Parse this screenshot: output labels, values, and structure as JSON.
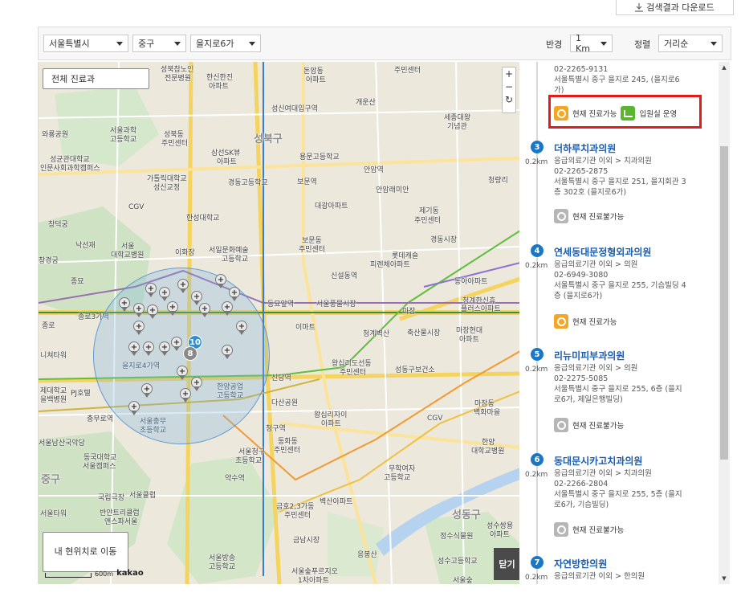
{
  "toolbar": {
    "download_label": "검색결과 다운로드",
    "download_icon": "download-icon"
  },
  "filters": {
    "sido": "서울특별시",
    "sigungu": "중구",
    "dong": "을지로6가",
    "radius_label": "반경",
    "radius_value": "1 Km",
    "sort_label": "정렬",
    "sort_value": "거리순"
  },
  "map": {
    "all_dept_button": "전체 진료과",
    "my_location_button": "내 현위치로 이동",
    "close_button": "닫기",
    "zoom_in": "+",
    "zoom_out": "−",
    "scale_text": "600m",
    "provider": "kakao",
    "clusters": [
      "10",
      "8"
    ],
    "labels": {
      "l1": "성북참노인",
      "l2": "전문병원",
      "l3": "한신한진",
      "l4": "아파트",
      "l5": "돈암동",
      "l6": "아파트",
      "l7": "주민센터",
      "l8": "성신여대입구역",
      "l9": "개운산",
      "l10": "와룡공원",
      "l11": "서울과학",
      "l12": "고등학교",
      "l13": "성북동",
      "l14": "주민센터",
      "l15": "성북구",
      "l16": "삼선SK뷰",
      "l17": "아파트",
      "l18": "용문고등학교",
      "l19": "세종대왕",
      "l20": "기념관",
      "l21": "성균관대학교",
      "l22": "인문사회과학캠퍼스",
      "l23": "가톨릭대학교",
      "l24": "성신교정",
      "l25": "경동고등학교",
      "l26": "보문역",
      "l27": "안암역",
      "l28": "안암래미안",
      "l29": "청량리",
      "l30": "CGV",
      "l31": "한성대학교",
      "l32": "대광아파트",
      "l33": "제기동",
      "l34": "주민센터",
      "l35": "창덕궁",
      "l36": "낙선재",
      "l37": "서울",
      "l38": "대학교병원",
      "l39": "이화장",
      "l40": "서일문화예술",
      "l41": "고등학교",
      "l42": "보문동",
      "l43": "주민센터",
      "l44": "경동시장",
      "l45": "종묘",
      "l46": "신설동역",
      "l47": "롯데캐슬",
      "l48": "피렌체아파트",
      "l49": "동아아파트",
      "l50": "종로3가역",
      "l51": "동묘앞역",
      "l52": "서울풍물시장",
      "l53": "청계한신휴",
      "l54": "플러스아파트",
      "l55": "이마트",
      "l56": "마장",
      "l57": "마장현대",
      "l58": "아파트",
      "l59": "청계벽산",
      "l60": "축산물시장",
      "l61": "니쳐타워",
      "l62": "을지로4가역",
      "l63": "왕십리도선동",
      "l64": "주민센터",
      "l65": "성동구보건소",
      "l66": "제대학교",
      "l67": "을백병원",
      "l68": "PJ호텔",
      "l69": "신당역",
      "l70": "한양공업",
      "l71": "고등학교",
      "l72": "다산공원",
      "l73": "마장동",
      "l74": "벽화마을",
      "l75": "충무로역",
      "l76": "서울충무",
      "l77": "초등학교",
      "l78": "왕십리자이",
      "l79": "아파트",
      "l80": "CGV",
      "l81": "서울남산국악당",
      "l82": "청구역",
      "l83": "동화동",
      "l84": "주민센터",
      "l85": "한양",
      "l86": "대학교병원",
      "l87": "동국대학교",
      "l88": "서울캠퍼스",
      "l89": "서울청구",
      "l90": "초등학교",
      "l91": "무학여자",
      "l92": "고등학교",
      "l93": "중구",
      "l94": "약수역",
      "l95": "국립극장",
      "l96": "서울클럽",
      "l97": "금호2,3가동",
      "l98": "주민센터",
      "l99": "벽산아파트",
      "l100": "성동구",
      "l101": "서울타워",
      "l102": "반얀트리클럽",
      "l103": "앤스파서울",
      "l104": "정수식물원",
      "l105": "성수쌍용",
      "l106": "아파트",
      "l107": "금남시장",
      "l108": "응봉산",
      "l109": "서울방송",
      "l110": "고등학교",
      "l111": "서울숲푸르지오",
      "l112": "1차아파트",
      "l113": "성수고등학교",
      "l114": "서울숲",
      "l115": "창경궁",
      "l116": "종로"
    }
  },
  "results": [
    {
      "num": "",
      "dist": "",
      "name": "",
      "lines": [
        "02-2265-9131",
        "서울특별시 중구 을지로 245, (을지로6",
        "가)"
      ],
      "badges": [
        {
          "icon": "clock-icon",
          "text": "현재 진료가능",
          "color": "#f5a623"
        },
        {
          "icon": "bed-icon",
          "text": "입원실 운영",
          "color": "#5cb531"
        }
      ]
    },
    {
      "num": "3",
      "dist": "0.2km",
      "name": "더하루치과의원",
      "lines": [
        "응급의료기관 이외 > 치과의원",
        "02-2265-2875",
        "서울특별시 중구 을지로 251, 을지회관 3",
        "층 302호 (을지로6가)"
      ],
      "badges": [
        {
          "icon": "clock-icon",
          "text": "현재 진료불가능",
          "color": "#b6b6b6"
        }
      ]
    },
    {
      "num": "4",
      "dist": "0.2km",
      "name": "연세동대문정형외과의원",
      "lines": [
        "응급의료기관 이외 > 의원",
        "02-6949-3080",
        "서울특별시 중구 을지로 255, 기슴빌딩 4",
        "층 (을지로6가)"
      ],
      "badges": [
        {
          "icon": "clock-icon",
          "text": "현재 진료가능",
          "color": "#f5a623"
        }
      ]
    },
    {
      "num": "5",
      "dist": "0.2km",
      "name": "리뉴미피부과의원",
      "lines": [
        "응급의료기관 이외 > 의원",
        "02-2275-5085",
        "서울특별시 중구 을지로 255, 6층 (을지",
        "로6가, 제일은행빌딩)"
      ],
      "badges": [
        {
          "icon": "clock-icon",
          "text": "현재 진료불가능",
          "color": "#b6b6b6"
        }
      ]
    },
    {
      "num": "6",
      "dist": "0.2km",
      "name": "동대문시카고치과의원",
      "lines": [
        "응급의료기관 이외 > 치과의원",
        "02-2266-2804",
        "서울특별시 중구 을지로 255, 5층 (을지",
        "로6가, 기슴빌딩)"
      ],
      "badges": [
        {
          "icon": "clock-icon",
          "text": "현재 진료불가능",
          "color": "#b6b6b6"
        }
      ]
    },
    {
      "num": "7",
      "dist": "0.2km",
      "name": "자연방한의원",
      "lines": [
        "응급의료기관 이외 > 한의원"
      ],
      "badges": []
    }
  ]
}
